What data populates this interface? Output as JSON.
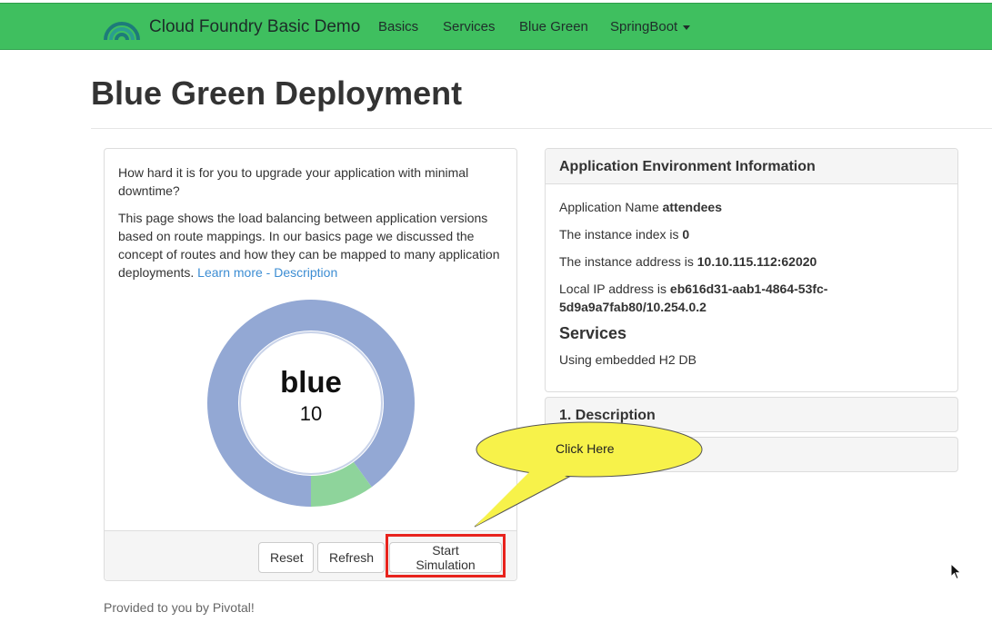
{
  "navbar": {
    "brand": "Cloud Foundry Basic Demo",
    "links": [
      {
        "label": "Basics"
      },
      {
        "label": "Services"
      },
      {
        "label": "Blue Green"
      },
      {
        "label": "SpringBoot"
      }
    ],
    "color": "#3fbf5f"
  },
  "page": {
    "title": "Blue Green Deployment"
  },
  "left_panel": {
    "intro": "How hard it is for you to upgrade your application with minimal downtime?",
    "description": "This page shows the load balancing between application versions based on route mappings. In our basics page we discussed the concept of routes and how they can be mapped to many application deployments.",
    "link": "Learn more - Description",
    "donut": {
      "label": "blue",
      "count": "10",
      "blue_fraction": 0.9,
      "green_fraction": 0.1,
      "blue_color": "#93a8d4",
      "green_color": "#8ed49b"
    },
    "buttons": {
      "reset": "Reset",
      "refresh": "Refresh",
      "start": "Start Simulation"
    }
  },
  "info_panel": {
    "heading": "Application Environment Information",
    "app_name_label": "Application Name",
    "app_name": "attendees",
    "index_label": "The instance index is",
    "index": "0",
    "address_label": "The instance address is",
    "address": "10.10.115.112:62020",
    "local_ip_label": "Local IP address is",
    "local_ip": "eb616d31-aab1-4864-53fc-5d9a9a7fab80/10.254.0.2",
    "services_title": "Services",
    "services_text": "Using embedded H2 DB"
  },
  "collapse_panels": [
    {
      "label": "1. Description"
    },
    {
      "label": ""
    }
  ],
  "callout": {
    "text": "Click Here",
    "color": "#f7f24a"
  },
  "footer": {
    "text": "Provided to you by Pivotal!"
  }
}
